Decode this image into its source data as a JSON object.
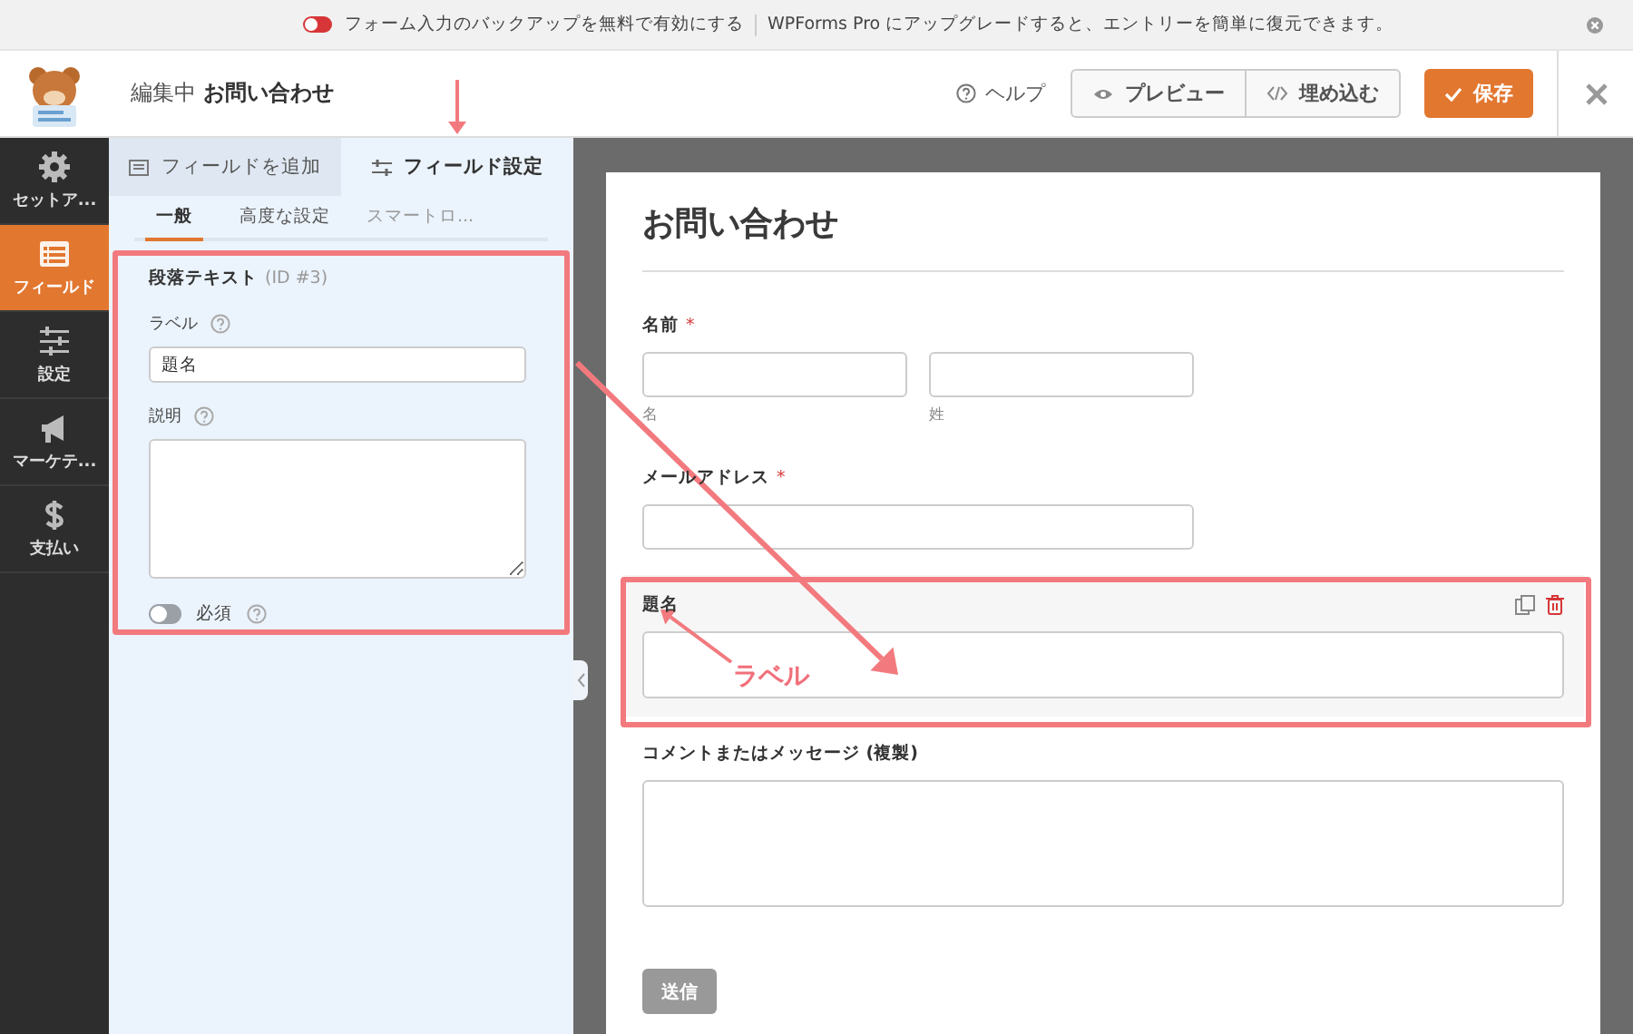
{
  "notice": {
    "toggle_on": false,
    "message": "フォーム入力のバックアップを無料で有効にする",
    "upgrade": "WPForms Pro にアップグレードすると、エントリーを簡単に復元できます。"
  },
  "header": {
    "editing": "編集中",
    "form_name": "お問い合わせ",
    "help": "ヘルプ",
    "preview": "プレビュー",
    "embed": "埋め込む",
    "save": "保存"
  },
  "sidebar": {
    "items": [
      {
        "label": "セットア...",
        "kind": "gear",
        "selected": false
      },
      {
        "label": "フィールド",
        "kind": "fields",
        "selected": true
      },
      {
        "label": "設定",
        "kind": "sliders",
        "selected": false
      },
      {
        "label": "マーケテ...",
        "kind": "megaphone",
        "selected": false
      },
      {
        "label": "支払い",
        "kind": "dollar",
        "selected": false
      }
    ]
  },
  "panel": {
    "tabs": [
      {
        "label": "フィールドを追加",
        "kind": "add",
        "selected": false
      },
      {
        "label": "フィールド設定",
        "kind": "settings",
        "selected": true
      }
    ],
    "subtabs": [
      {
        "label": "一般",
        "selected": true
      },
      {
        "label": "高度な設定",
        "selected": false
      },
      {
        "label": "スマートロ...",
        "selected": false
      }
    ],
    "options": {
      "title": "段落テキスト",
      "id": "(ID #3)",
      "label_caption": "ラベル",
      "label_value": "題名",
      "description_caption": "説明",
      "required_caption": "必須",
      "required_on": false
    }
  },
  "form": {
    "title": "お問い合わせ",
    "fields": [
      {
        "kind": "name",
        "label": "名前",
        "required_mark": "*",
        "sublabels": [
          "名",
          "姓"
        ],
        "selected": false
      },
      {
        "kind": "text",
        "label": "メールアドレス",
        "required_mark": "*",
        "selected": false
      },
      {
        "kind": "text",
        "label": "題名",
        "selected": true
      },
      {
        "kind": "textarea",
        "label": "コメントまたはメッセージ (複製)",
        "selected": false
      }
    ],
    "submit": "送信"
  },
  "annotations": [
    {
      "text": "ラベル"
    }
  ]
}
